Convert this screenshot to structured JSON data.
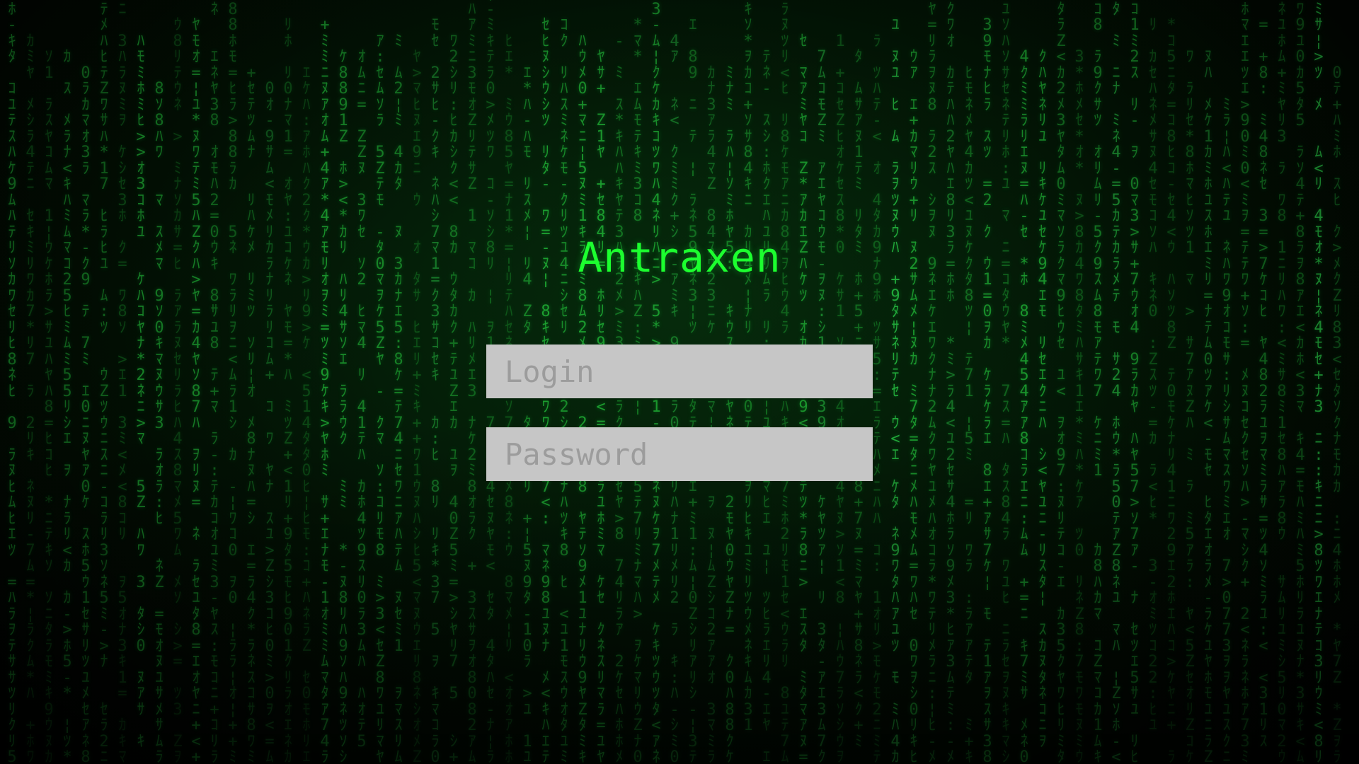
{
  "app": {
    "title": "Antraxen"
  },
  "form": {
    "login_placeholder": "Login",
    "password_placeholder": "Password",
    "login_value": "",
    "password_value": ""
  },
  "theme": {
    "title_color": "#1cff2f",
    "rain_color": "#1fae34",
    "background_color": "#021004",
    "field_background": "#c6c6c6",
    "placeholder_color": "#9c9c9c"
  },
  "background": {
    "type": "matrix-code-rain",
    "glyphs": "ｦｱｳｴｵｶｷｹｺｻｼｽｾｿﾀﾂﾃﾅﾆﾇﾈﾊﾋﾎﾏﾐﾑﾒﾓﾔﾕﾗﾘﾜ0123457889=<>:-+*¦Zｸﾗﾘﾊﾐ"
  }
}
